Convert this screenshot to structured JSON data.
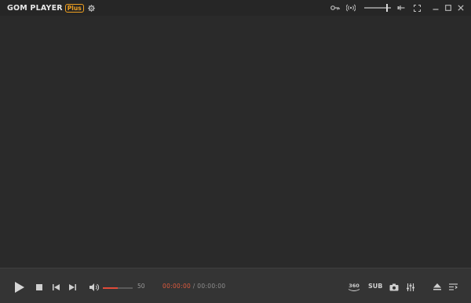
{
  "app": {
    "name": "GOM PLAYER",
    "badge": "Plus"
  },
  "titlebar": {
    "icons": [
      "gear-icon",
      "key-icon",
      "broadcast-icon",
      "opacity-slider",
      "pin-icon",
      "fullscreen-icon",
      "minimize-icon",
      "maximize-icon",
      "close-icon"
    ],
    "opacity_level": 0.85
  },
  "controls": {
    "volume_value": "50",
    "volume_level": 0.5,
    "time_current": "00:00:00",
    "time_separator": "/",
    "time_total": "00:00:00",
    "label_360": "360",
    "label_sub": "SUB"
  },
  "colors": {
    "accent": "#e05a3c",
    "plus_badge": "#f0a020",
    "background": "#2a2a2a",
    "control_bar": "#343434"
  }
}
